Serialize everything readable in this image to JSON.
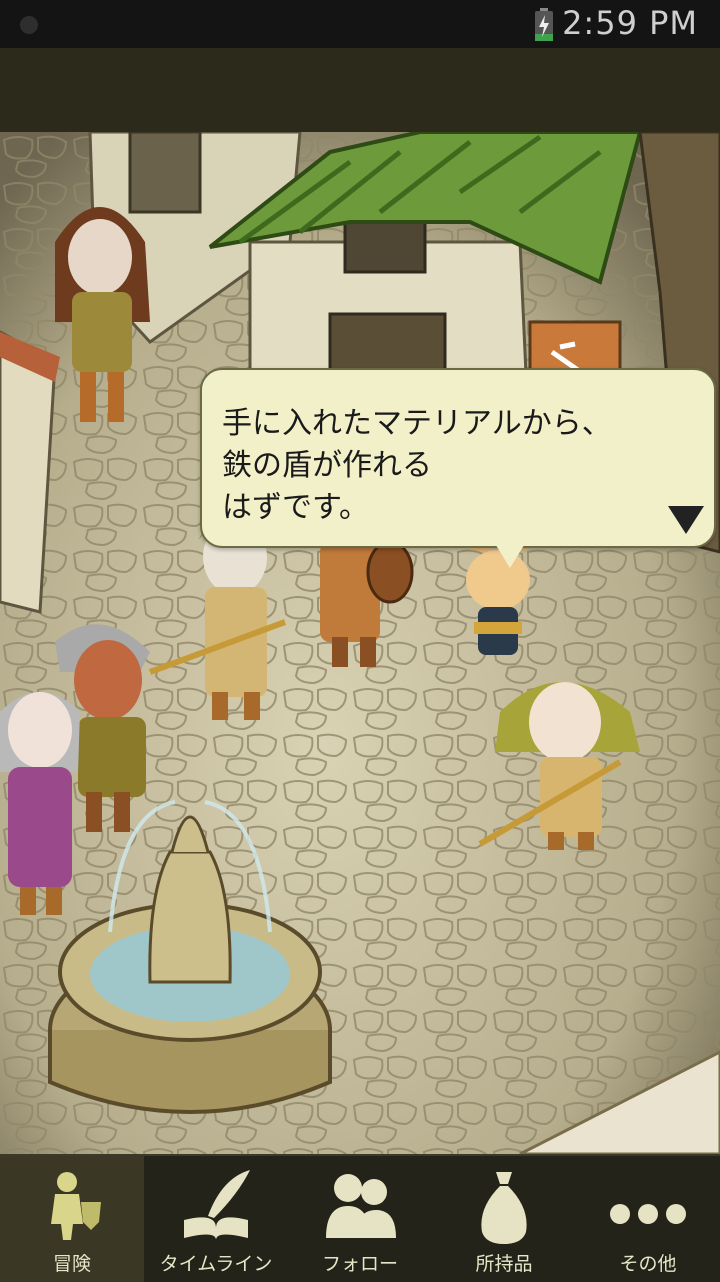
{
  "status_bar": {
    "time": "2:59 PM",
    "battery_icon": "battery-charging-icon"
  },
  "dialog": {
    "lines": [
      "手に入れたマテリアルから、",
      "鉄の盾が作れる",
      "はずです。"
    ],
    "next_icon": "triangle-down-icon"
  },
  "tabs": [
    {
      "label": "冒険",
      "icon": "adventurer-icon",
      "active": true
    },
    {
      "label": "タイムライン",
      "icon": "quill-book-icon",
      "active": false
    },
    {
      "label": "フォロー",
      "icon": "people-icon",
      "active": false
    },
    {
      "label": "所持品",
      "icon": "money-bag-icon",
      "active": false
    },
    {
      "label": "その他",
      "icon": "more-dots-icon",
      "active": false
    }
  ],
  "colors": {
    "tab_bg": "#23231a",
    "tab_active_bg": "#3a3825",
    "bubble_bg": "#f2f0c8",
    "roof_green": "#6d9a3a"
  }
}
